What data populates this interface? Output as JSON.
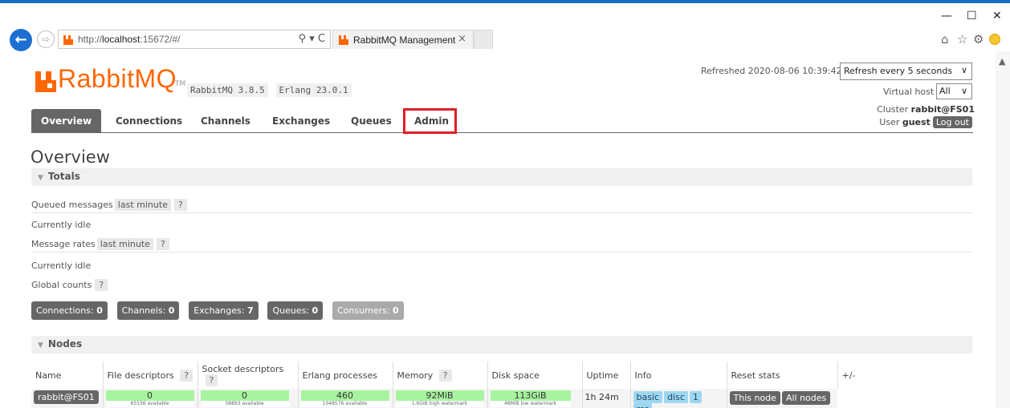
{
  "browser": {
    "url_prefix": "http://",
    "url_host": "localhost",
    "url_rest": ":15672/#/",
    "addr_controls": "⚲ ▾ C",
    "tab_title": "RabbitMQ Management",
    "tab_close": "×",
    "minimize": "—",
    "maximize": "☐",
    "close": "✕",
    "tools": [
      "⌂",
      "☆",
      "⚙"
    ]
  },
  "header": {
    "logo_text": "RabbitMQ",
    "logo_tm": "TM",
    "version": "RabbitMQ 3.8.5",
    "erlang": "Erlang 23.0.1",
    "refreshed_label": "Refreshed 2020-08-06 10:39:42",
    "refresh_select": "Refresh every 5 seconds",
    "vhost_label": "Virtual host",
    "vhost_value": "All",
    "cluster_label": "Cluster",
    "cluster_name": "rabbit@FS01",
    "user_label": "User",
    "user_name": "guest",
    "logout": "Log out"
  },
  "nav": {
    "overview": "Overview",
    "connections": "Connections",
    "channels": "Channels",
    "exchanges": "Exchanges",
    "queues": "Queues",
    "admin": "Admin"
  },
  "page_title": "Overview",
  "totals": {
    "section_label": "Totals",
    "queued_label": "Queued messages",
    "queued_range": "last minute",
    "help": "?",
    "idle1": "Currently idle",
    "rates_label": "Message rates",
    "rates_range": "last minute",
    "idle2": "Currently idle",
    "global_label": "Global counts"
  },
  "counts": {
    "connections_label": "Connections:",
    "connections": "0",
    "channels_label": "Channels:",
    "channels": "0",
    "exchanges_label": "Exchanges:",
    "exchanges": "7",
    "queues_label": "Queues:",
    "queues": "0",
    "consumers_label": "Consumers:",
    "consumers": "0"
  },
  "nodes": {
    "section_label": "Nodes",
    "headers": {
      "name": "Name",
      "fd": "File descriptors",
      "sd": "Socket descriptors",
      "ep": "Erlang processes",
      "mem": "Memory",
      "disk": "Disk space",
      "uptime": "Uptime",
      "info": "Info",
      "reset": "Reset stats",
      "plusminus": "+/-"
    },
    "row": {
      "name": "rabbit@FS01",
      "fd": "0",
      "fd_sub": "65536 available",
      "sd": "0",
      "sd_sub": "58893 available",
      "ep": "460",
      "ep_sub": "1048576 available",
      "mem": "92MiB",
      "mem_sub": "1.6GiB high watermark",
      "disk": "113GiB",
      "disk_sub": "48MiB low watermark",
      "uptime": "1h 24m",
      "info": [
        "basic",
        "disc",
        "1",
        "rss"
      ],
      "reset_this": "This node",
      "reset_all": "All nodes"
    }
  }
}
